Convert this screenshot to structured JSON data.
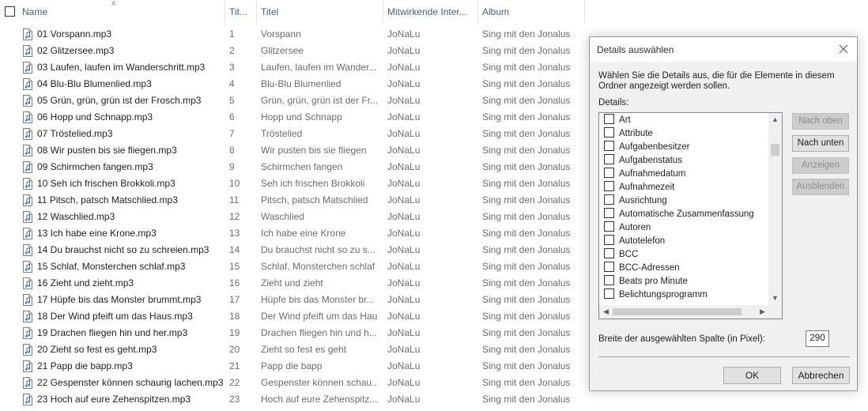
{
  "columns": {
    "name": "Name",
    "track": "Tit...",
    "title": "Titel",
    "artist": "Mitwirkende Inter...",
    "album": "Album"
  },
  "files": [
    {
      "name": "01 Vorspann.mp3",
      "track": "1",
      "title": "Vorspann",
      "artist": "JoNaLu",
      "album": "Sing mit den Jonalus"
    },
    {
      "name": "02 Glitzersee.mp3",
      "track": "2",
      "title": "Glitzersee",
      "artist": "JoNaLu",
      "album": "Sing mit den Jonalus"
    },
    {
      "name": "03 Laufen, laufen im Wanderschritt.mp3",
      "track": "3",
      "title": "Laufen, laufen im Wander...",
      "artist": "JoNaLu",
      "album": "Sing mit den Jonalus"
    },
    {
      "name": "04 Blu-Blu Blumenlied.mp3",
      "track": "4",
      "title": "Blu-Blu Blumenlied",
      "artist": "JoNaLu",
      "album": "Sing mit den Jonalus"
    },
    {
      "name": "05 Grün, grün, grün ist der Frosch.mp3",
      "track": "5",
      "title": "Grün, grün, grün ist der Fr...",
      "artist": "JoNaLu",
      "album": "Sing mit den Jonalus"
    },
    {
      "name": "06 Hopp und Schnapp.mp3",
      "track": "6",
      "title": "Hopp und Schnapp",
      "artist": "JoNaLu",
      "album": "Sing mit den Jonalus"
    },
    {
      "name": "07 Tröstelied.mp3",
      "track": "7",
      "title": "Tröstelied",
      "artist": "JoNaLu",
      "album": "Sing mit den Jonalus"
    },
    {
      "name": "08 Wir pusten bis sie fliegen.mp3",
      "track": "8",
      "title": "Wir pusten bis sie fliegen",
      "artist": "JoNaLu",
      "album": "Sing mit den Jonalus"
    },
    {
      "name": "09 Schirmchen fangen.mp3",
      "track": "9",
      "title": "Schirmchen fangen",
      "artist": "JoNaLu",
      "album": "Sing mit den Jonalus"
    },
    {
      "name": "10 Seh ich frischen Brokkoli.mp3",
      "track": "10",
      "title": "Seh ich frischen Brokkoli",
      "artist": "JoNaLu",
      "album": "Sing mit den Jonalus"
    },
    {
      "name": "11 Pitsch, patsch Matschlied.mp3",
      "track": "11",
      "title": "Pitsch, patsch Matschlied",
      "artist": "JoNaLu",
      "album": "Sing mit den Jonalus"
    },
    {
      "name": "12 Waschlied.mp3",
      "track": "12",
      "title": "Waschlied",
      "artist": "JoNaLu",
      "album": "Sing mit den Jonalus"
    },
    {
      "name": "13 Ich habe eine Krone.mp3",
      "track": "13",
      "title": "Ich habe eine Krone",
      "artist": "JoNaLu",
      "album": "Sing mit den Jonalus"
    },
    {
      "name": "14 Du brauchst nicht so zu schreien.mp3",
      "track": "14",
      "title": "Du brauchst nicht so zu s...",
      "artist": "JoNaLu",
      "album": "Sing mit den Jonalus"
    },
    {
      "name": "15 Schlaf, Monsterchen schlaf.mp3",
      "track": "15",
      "title": "Schlaf, Monsterchen schlaf",
      "artist": "JoNaLu",
      "album": "Sing mit den Jonalus"
    },
    {
      "name": "16 Zieht und zieht.mp3",
      "track": "16",
      "title": "Zieht und zieht",
      "artist": "JoNaLu",
      "album": "Sing mit den Jonalus"
    },
    {
      "name": "17 Hüpfe bis das Monster brummt.mp3",
      "track": "17",
      "title": "Hüpfe bis das Monster br...",
      "artist": "JoNaLu",
      "album": "Sing mit den Jonalus"
    },
    {
      "name": "18 Der Wind pfeift um das Haus.mp3",
      "track": "18",
      "title": "Der Wind pfeift um das Hau...",
      "artist": "JoNaLu",
      "album": "Sing mit den Jonalus"
    },
    {
      "name": "19 Drachen fliegen hin und her.mp3",
      "track": "19",
      "title": "Drachen fliegen hin und h...",
      "artist": "JoNaLu",
      "album": "Sing mit den Jonalus"
    },
    {
      "name": "20 Zieht so fest es geht.mp3",
      "track": "20",
      "title": "Zieht so fest es geht",
      "artist": "JoNaLu",
      "album": "Sing mit den Jonalus"
    },
    {
      "name": "21 Papp die bapp.mp3",
      "track": "21",
      "title": "Papp die bapp",
      "artist": "JoNaLu",
      "album": "Sing mit den Jonalus"
    },
    {
      "name": "22 Gespenster können schaurig lachen.mp3",
      "track": "22",
      "title": "Gespenster können schau...",
      "artist": "JoNaLu",
      "album": "Sing mit den Jonalus"
    },
    {
      "name": "23 Hoch auf eure Zehenspitzen.mp3",
      "track": "23",
      "title": "Hoch auf eure Zehenspitz...",
      "artist": "JoNaLu",
      "album": "Sing mit den Jonalus"
    }
  ],
  "dialog": {
    "title": "Details auswählen",
    "description": "Wählen Sie die Details aus, die für die Elemente in diesem Ordner angezeigt werden sollen.",
    "details_label": "Details:",
    "details": [
      "Art",
      "Attribute",
      "Aufgabenbesitzer",
      "Aufgabenstatus",
      "Aufnahmedatum",
      "Aufnahmezeit",
      "Ausrichtung",
      "Automatische Zusammenfassung",
      "Autoren",
      "Autotelefon",
      "BCC",
      "BCC-Adressen",
      "Beats pro Minute",
      "Belichtungsprogramm"
    ],
    "buttons": {
      "move_up": "Nach oben",
      "move_down": "Nach unten",
      "show": "Anzeigen",
      "hide": "Ausblenden"
    },
    "width_label": "Breite der ausgewählten Spalte (in Pixel):",
    "width_value": "290",
    "ok": "OK",
    "cancel": "Abbrechen"
  },
  "icons": {
    "close": "close-icon",
    "audio_file": "audio-file-icon",
    "sort": "sort-ascending-icon"
  },
  "colors": {
    "header_text": "#4c607a",
    "secondary_text": "#6d6d6d",
    "dialog_bg": "#f0f0f0",
    "disabled_text": "#8d8d8d"
  }
}
